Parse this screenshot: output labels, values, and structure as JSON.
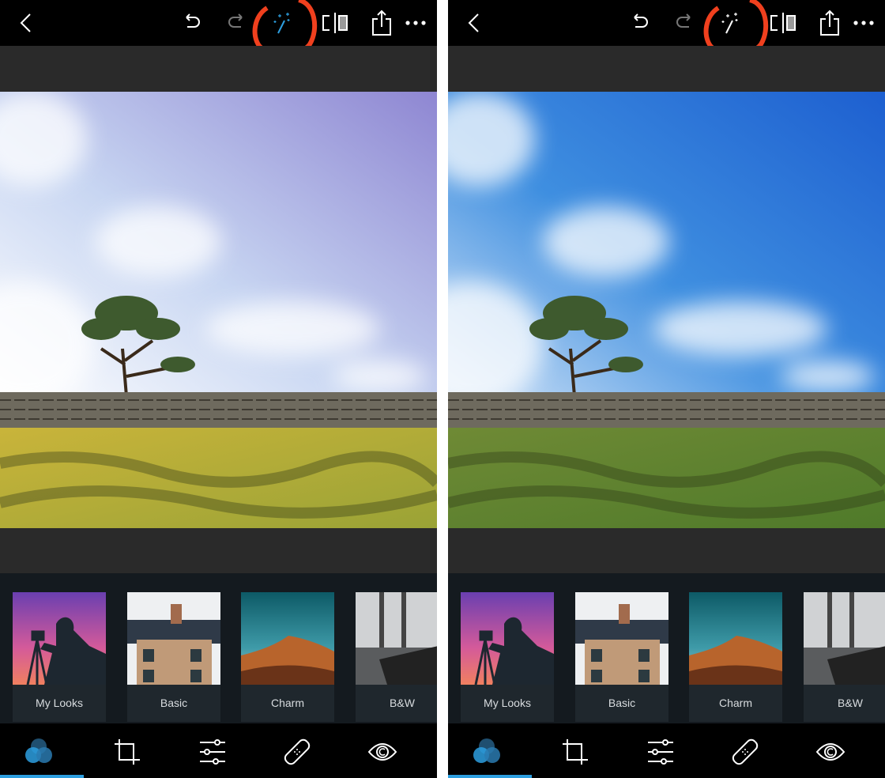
{
  "panels": [
    {
      "id": "before",
      "magic_wand_active": true,
      "sky_colors": [
        "#ffffff",
        "#c8d6f2",
        "#8e86d2"
      ],
      "ground_colors": [
        "#c9b43a",
        "#9aa336"
      ],
      "filters": [
        {
          "label": "My Looks"
        },
        {
          "label": "Basic"
        },
        {
          "label": "Charm"
        },
        {
          "label": "B&W"
        }
      ]
    },
    {
      "id": "after",
      "magic_wand_active": false,
      "sky_colors": [
        "#d6e6f8",
        "#3f8fe0",
        "#1d5fd0"
      ],
      "ground_colors": [
        "#6f8a35",
        "#4f7a2a"
      ],
      "filters": [
        {
          "label": "My Looks"
        },
        {
          "label": "Basic"
        },
        {
          "label": "Charm"
        },
        {
          "label": "B&W"
        }
      ]
    }
  ],
  "toolbar_icons": [
    "back-icon",
    "undo-icon",
    "redo-icon",
    "magic-wand-icon",
    "compare-icon",
    "share-icon",
    "more-icon"
  ],
  "bottom_tabs": [
    "looks-icon",
    "crop-icon",
    "adjustments-icon",
    "healing-icon",
    "eye-icon"
  ],
  "colors": {
    "accent": "#2d9fe0",
    "annotation": "#f0401e"
  }
}
